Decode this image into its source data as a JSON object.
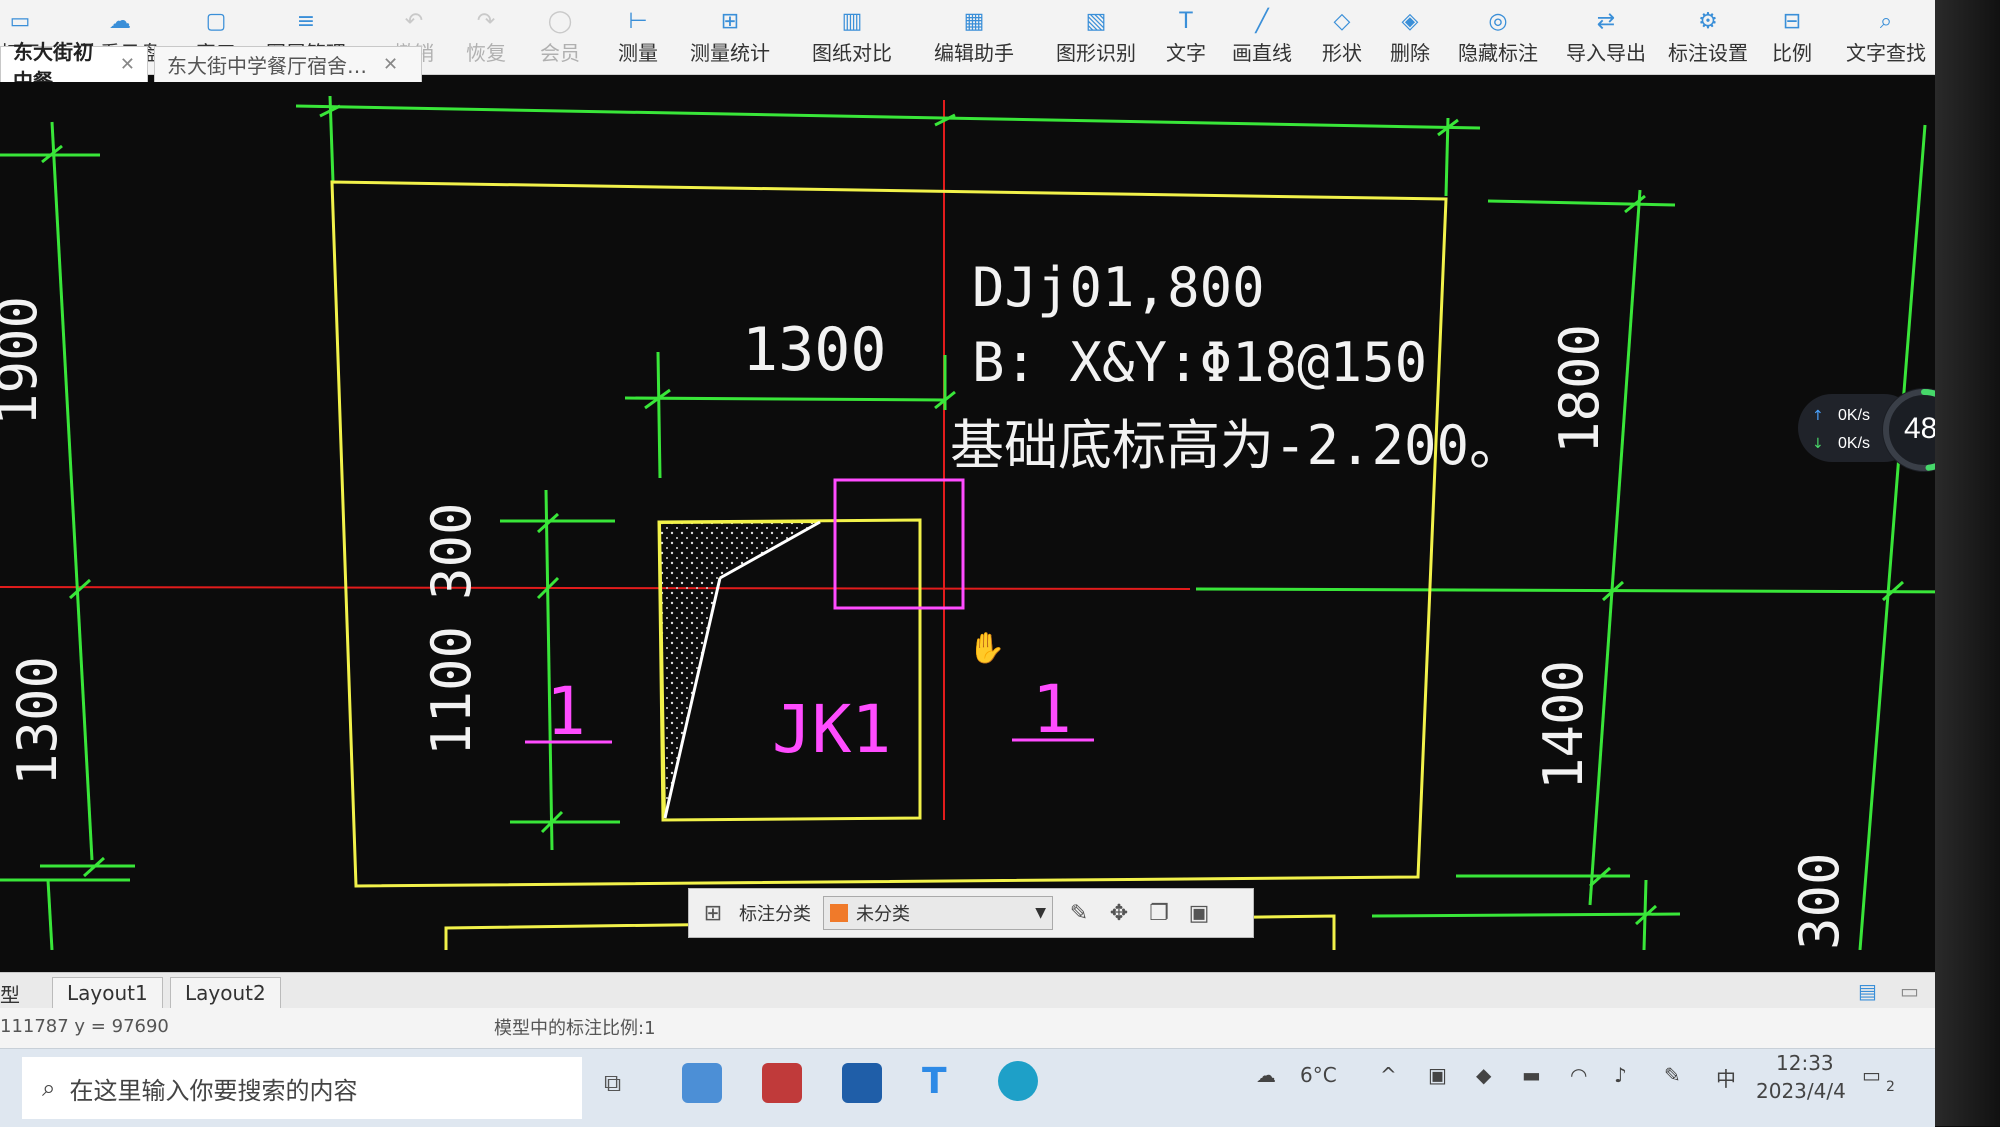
{
  "toolbar": {
    "items": [
      {
        "label": "打开",
        "icon": "open-icon",
        "muted": false
      },
      {
        "label": "快看云盘",
        "icon": "cloud-icon",
        "muted": false
      },
      {
        "label": "窗口",
        "icon": "window-icon",
        "muted": false
      },
      {
        "label": "图层管理",
        "icon": "layers-icon",
        "muted": false
      },
      {
        "label": "撤销",
        "icon": "undo-icon",
        "muted": true
      },
      {
        "label": "恢复",
        "icon": "redo-icon",
        "muted": true
      },
      {
        "label": "会员",
        "icon": "vip-icon",
        "muted": true
      },
      {
        "label": "测量",
        "icon": "measure-icon",
        "muted": false
      },
      {
        "label": "测量统计",
        "icon": "measure-stats-icon",
        "muted": false
      },
      {
        "label": "图纸对比",
        "icon": "compare-icon",
        "muted": false
      },
      {
        "label": "编辑助手",
        "icon": "edit-assistant-icon",
        "muted": false
      },
      {
        "label": "图形识别",
        "icon": "shape-recognize-icon",
        "muted": false
      },
      {
        "label": "文字",
        "icon": "text-icon",
        "muted": false
      },
      {
        "label": "画直线",
        "icon": "line-icon",
        "muted": false
      },
      {
        "label": "形状",
        "icon": "shape-icon",
        "muted": false
      },
      {
        "label": "删除",
        "icon": "eraser-icon",
        "muted": false
      },
      {
        "label": "隐藏标注",
        "icon": "hide-eye-icon",
        "muted": false
      },
      {
        "label": "导入导出",
        "icon": "import-export-icon",
        "muted": false
      },
      {
        "label": "标注设置",
        "icon": "annotation-settings-icon",
        "muted": false
      },
      {
        "label": "比例",
        "icon": "scale-icon",
        "muted": false
      },
      {
        "label": "文字查找",
        "icon": "text-search-icon",
        "muted": false
      }
    ]
  },
  "tabs": [
    {
      "label": "东大街初中餐…",
      "active": true
    },
    {
      "label": "东大街中学餐厅宿舍…",
      "active": false
    }
  ],
  "drawing": {
    "title": "DJj01,800",
    "rebar": "B: X&Y:Φ18@150",
    "elevation": "基础底标高为-2.200。",
    "dim_width": "1300",
    "dim_300": "300",
    "dim_1100": "1100",
    "dim_1800": "1800",
    "dim_1400": "1400",
    "dim_left_top": "1900",
    "dim_left_bottom": "1300",
    "dim_right_bottom": "300",
    "column_label": "JK1",
    "section_mark_left": "1",
    "section_mark_right": "1"
  },
  "float_bar": {
    "label": "标注分类",
    "select_value": "未分类",
    "swatch_color": "#f07a2a"
  },
  "layout_tabs": [
    "型",
    "Layout1",
    "Layout2"
  ],
  "status": {
    "coords": "111787  y = 97690",
    "scale_text": "模型中的标注比例:1"
  },
  "network": {
    "up": "0K/s",
    "down": "0K/s",
    "percent": "48%",
    "percent_value": 48
  },
  "taskbar": {
    "search_placeholder": "在这里输入你要搜索的内容",
    "weather": "6°C",
    "ime": "中",
    "time": "12:33",
    "date": "2023/4/4",
    "notifications": "2"
  },
  "colors": {
    "dim_green": "#39e639",
    "yellow": "#f2f24a",
    "magenta": "#ff4cff",
    "red_axis": "#e21c1c",
    "text_white": "#f2f2f2"
  }
}
